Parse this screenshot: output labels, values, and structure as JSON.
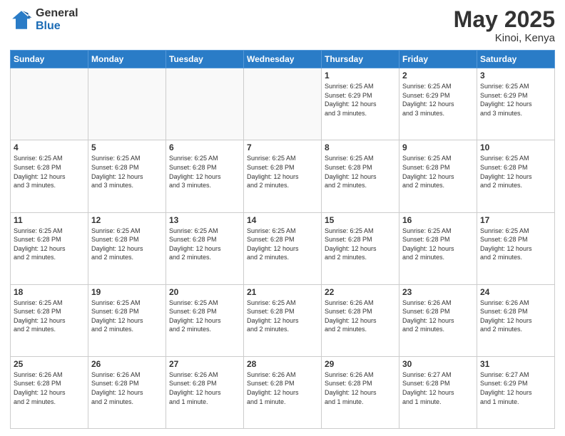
{
  "header": {
    "logo_general": "General",
    "logo_blue": "Blue",
    "main_title": "May 2025",
    "subtitle": "Kinoi, Kenya"
  },
  "calendar": {
    "days_of_week": [
      "Sunday",
      "Monday",
      "Tuesday",
      "Wednesday",
      "Thursday",
      "Friday",
      "Saturday"
    ],
    "weeks": [
      [
        {
          "day": "",
          "info": ""
        },
        {
          "day": "",
          "info": ""
        },
        {
          "day": "",
          "info": ""
        },
        {
          "day": "",
          "info": ""
        },
        {
          "day": "1",
          "info": "Sunrise: 6:25 AM\nSunset: 6:29 PM\nDaylight: 12 hours\nand 3 minutes."
        },
        {
          "day": "2",
          "info": "Sunrise: 6:25 AM\nSunset: 6:29 PM\nDaylight: 12 hours\nand 3 minutes."
        },
        {
          "day": "3",
          "info": "Sunrise: 6:25 AM\nSunset: 6:29 PM\nDaylight: 12 hours\nand 3 minutes."
        }
      ],
      [
        {
          "day": "4",
          "info": "Sunrise: 6:25 AM\nSunset: 6:28 PM\nDaylight: 12 hours\nand 3 minutes."
        },
        {
          "day": "5",
          "info": "Sunrise: 6:25 AM\nSunset: 6:28 PM\nDaylight: 12 hours\nand 3 minutes."
        },
        {
          "day": "6",
          "info": "Sunrise: 6:25 AM\nSunset: 6:28 PM\nDaylight: 12 hours\nand 3 minutes."
        },
        {
          "day": "7",
          "info": "Sunrise: 6:25 AM\nSunset: 6:28 PM\nDaylight: 12 hours\nand 2 minutes."
        },
        {
          "day": "8",
          "info": "Sunrise: 6:25 AM\nSunset: 6:28 PM\nDaylight: 12 hours\nand 2 minutes."
        },
        {
          "day": "9",
          "info": "Sunrise: 6:25 AM\nSunset: 6:28 PM\nDaylight: 12 hours\nand 2 minutes."
        },
        {
          "day": "10",
          "info": "Sunrise: 6:25 AM\nSunset: 6:28 PM\nDaylight: 12 hours\nand 2 minutes."
        }
      ],
      [
        {
          "day": "11",
          "info": "Sunrise: 6:25 AM\nSunset: 6:28 PM\nDaylight: 12 hours\nand 2 minutes."
        },
        {
          "day": "12",
          "info": "Sunrise: 6:25 AM\nSunset: 6:28 PM\nDaylight: 12 hours\nand 2 minutes."
        },
        {
          "day": "13",
          "info": "Sunrise: 6:25 AM\nSunset: 6:28 PM\nDaylight: 12 hours\nand 2 minutes."
        },
        {
          "day": "14",
          "info": "Sunrise: 6:25 AM\nSunset: 6:28 PM\nDaylight: 12 hours\nand 2 minutes."
        },
        {
          "day": "15",
          "info": "Sunrise: 6:25 AM\nSunset: 6:28 PM\nDaylight: 12 hours\nand 2 minutes."
        },
        {
          "day": "16",
          "info": "Sunrise: 6:25 AM\nSunset: 6:28 PM\nDaylight: 12 hours\nand 2 minutes."
        },
        {
          "day": "17",
          "info": "Sunrise: 6:25 AM\nSunset: 6:28 PM\nDaylight: 12 hours\nand 2 minutes."
        }
      ],
      [
        {
          "day": "18",
          "info": "Sunrise: 6:25 AM\nSunset: 6:28 PM\nDaylight: 12 hours\nand 2 minutes."
        },
        {
          "day": "19",
          "info": "Sunrise: 6:25 AM\nSunset: 6:28 PM\nDaylight: 12 hours\nand 2 minutes."
        },
        {
          "day": "20",
          "info": "Sunrise: 6:25 AM\nSunset: 6:28 PM\nDaylight: 12 hours\nand 2 minutes."
        },
        {
          "day": "21",
          "info": "Sunrise: 6:25 AM\nSunset: 6:28 PM\nDaylight: 12 hours\nand 2 minutes."
        },
        {
          "day": "22",
          "info": "Sunrise: 6:26 AM\nSunset: 6:28 PM\nDaylight: 12 hours\nand 2 minutes."
        },
        {
          "day": "23",
          "info": "Sunrise: 6:26 AM\nSunset: 6:28 PM\nDaylight: 12 hours\nand 2 minutes."
        },
        {
          "day": "24",
          "info": "Sunrise: 6:26 AM\nSunset: 6:28 PM\nDaylight: 12 hours\nand 2 minutes."
        }
      ],
      [
        {
          "day": "25",
          "info": "Sunrise: 6:26 AM\nSunset: 6:28 PM\nDaylight: 12 hours\nand 2 minutes."
        },
        {
          "day": "26",
          "info": "Sunrise: 6:26 AM\nSunset: 6:28 PM\nDaylight: 12 hours\nand 2 minutes."
        },
        {
          "day": "27",
          "info": "Sunrise: 6:26 AM\nSunset: 6:28 PM\nDaylight: 12 hours\nand 1 minute."
        },
        {
          "day": "28",
          "info": "Sunrise: 6:26 AM\nSunset: 6:28 PM\nDaylight: 12 hours\nand 1 minute."
        },
        {
          "day": "29",
          "info": "Sunrise: 6:26 AM\nSunset: 6:28 PM\nDaylight: 12 hours\nand 1 minute."
        },
        {
          "day": "30",
          "info": "Sunrise: 6:27 AM\nSunset: 6:28 PM\nDaylight: 12 hours\nand 1 minute."
        },
        {
          "day": "31",
          "info": "Sunrise: 6:27 AM\nSunset: 6:29 PM\nDaylight: 12 hours\nand 1 minute."
        }
      ]
    ]
  }
}
